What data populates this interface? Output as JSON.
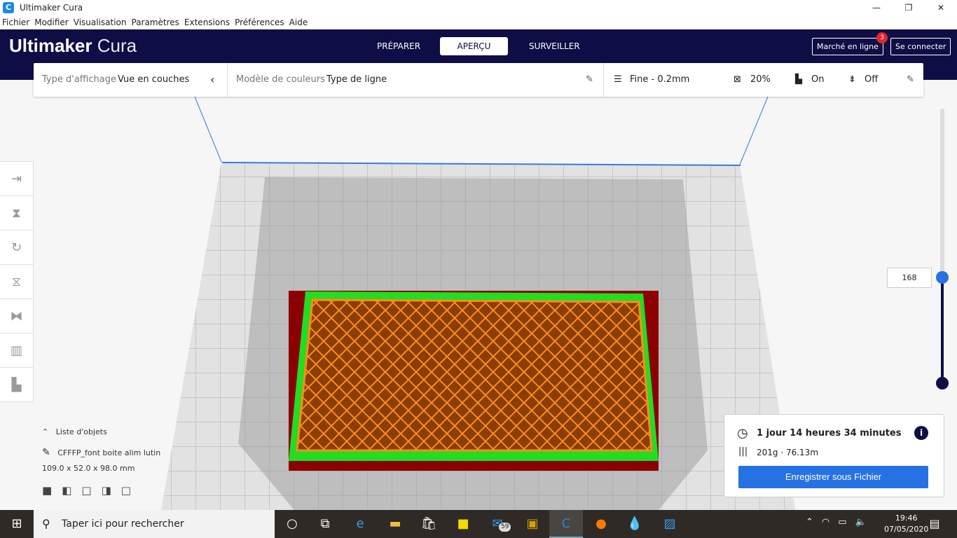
{
  "window": {
    "title": "Ultimaker Cura"
  },
  "menu": [
    "Fichier",
    "Modifier",
    "Visualisation",
    "Paramètres",
    "Extensions",
    "Préférences",
    "Aide"
  ],
  "header": {
    "brand_bold": "Ultimaker",
    "brand_light": "Cura",
    "stages": [
      "PRÉPARER",
      "APERÇU",
      "SURVEILLER"
    ],
    "active_stage": "APERÇU",
    "marketplace": "Marché en ligne",
    "marketplace_badge": "3",
    "login": "Se connecter"
  },
  "toolbar": {
    "view_type_label": "Type d'affichage",
    "view_type_value": "Vue en couches",
    "color_model_label": "Modèle de couleurs",
    "color_model_value": "Type de ligne",
    "profile": "Fine - 0.2mm",
    "infill": "20%",
    "support": "On",
    "adhesion": "Off"
  },
  "layer_slider": {
    "current_layer": "168"
  },
  "objects": {
    "header": "Liste d'objets",
    "name": "CFFFP_font boite alim lutin",
    "dimensions": "109.0 x 52.0 x 98.0 mm"
  },
  "estimate": {
    "time": "1 jour 14 heures 34 minutes",
    "material": "201g · 76.13m",
    "save_button": "Enregistrer sous Fichier"
  },
  "taskbar": {
    "search_placeholder": "Taper ici pour rechercher",
    "mail_badge": "59",
    "time": "19:46",
    "date": "07/05/2020"
  },
  "colors": {
    "header": "#0f0d45",
    "accent": "#2671e3",
    "shell": "#8b0000",
    "wall": "#22dd22",
    "infill": "#ff8c00"
  }
}
